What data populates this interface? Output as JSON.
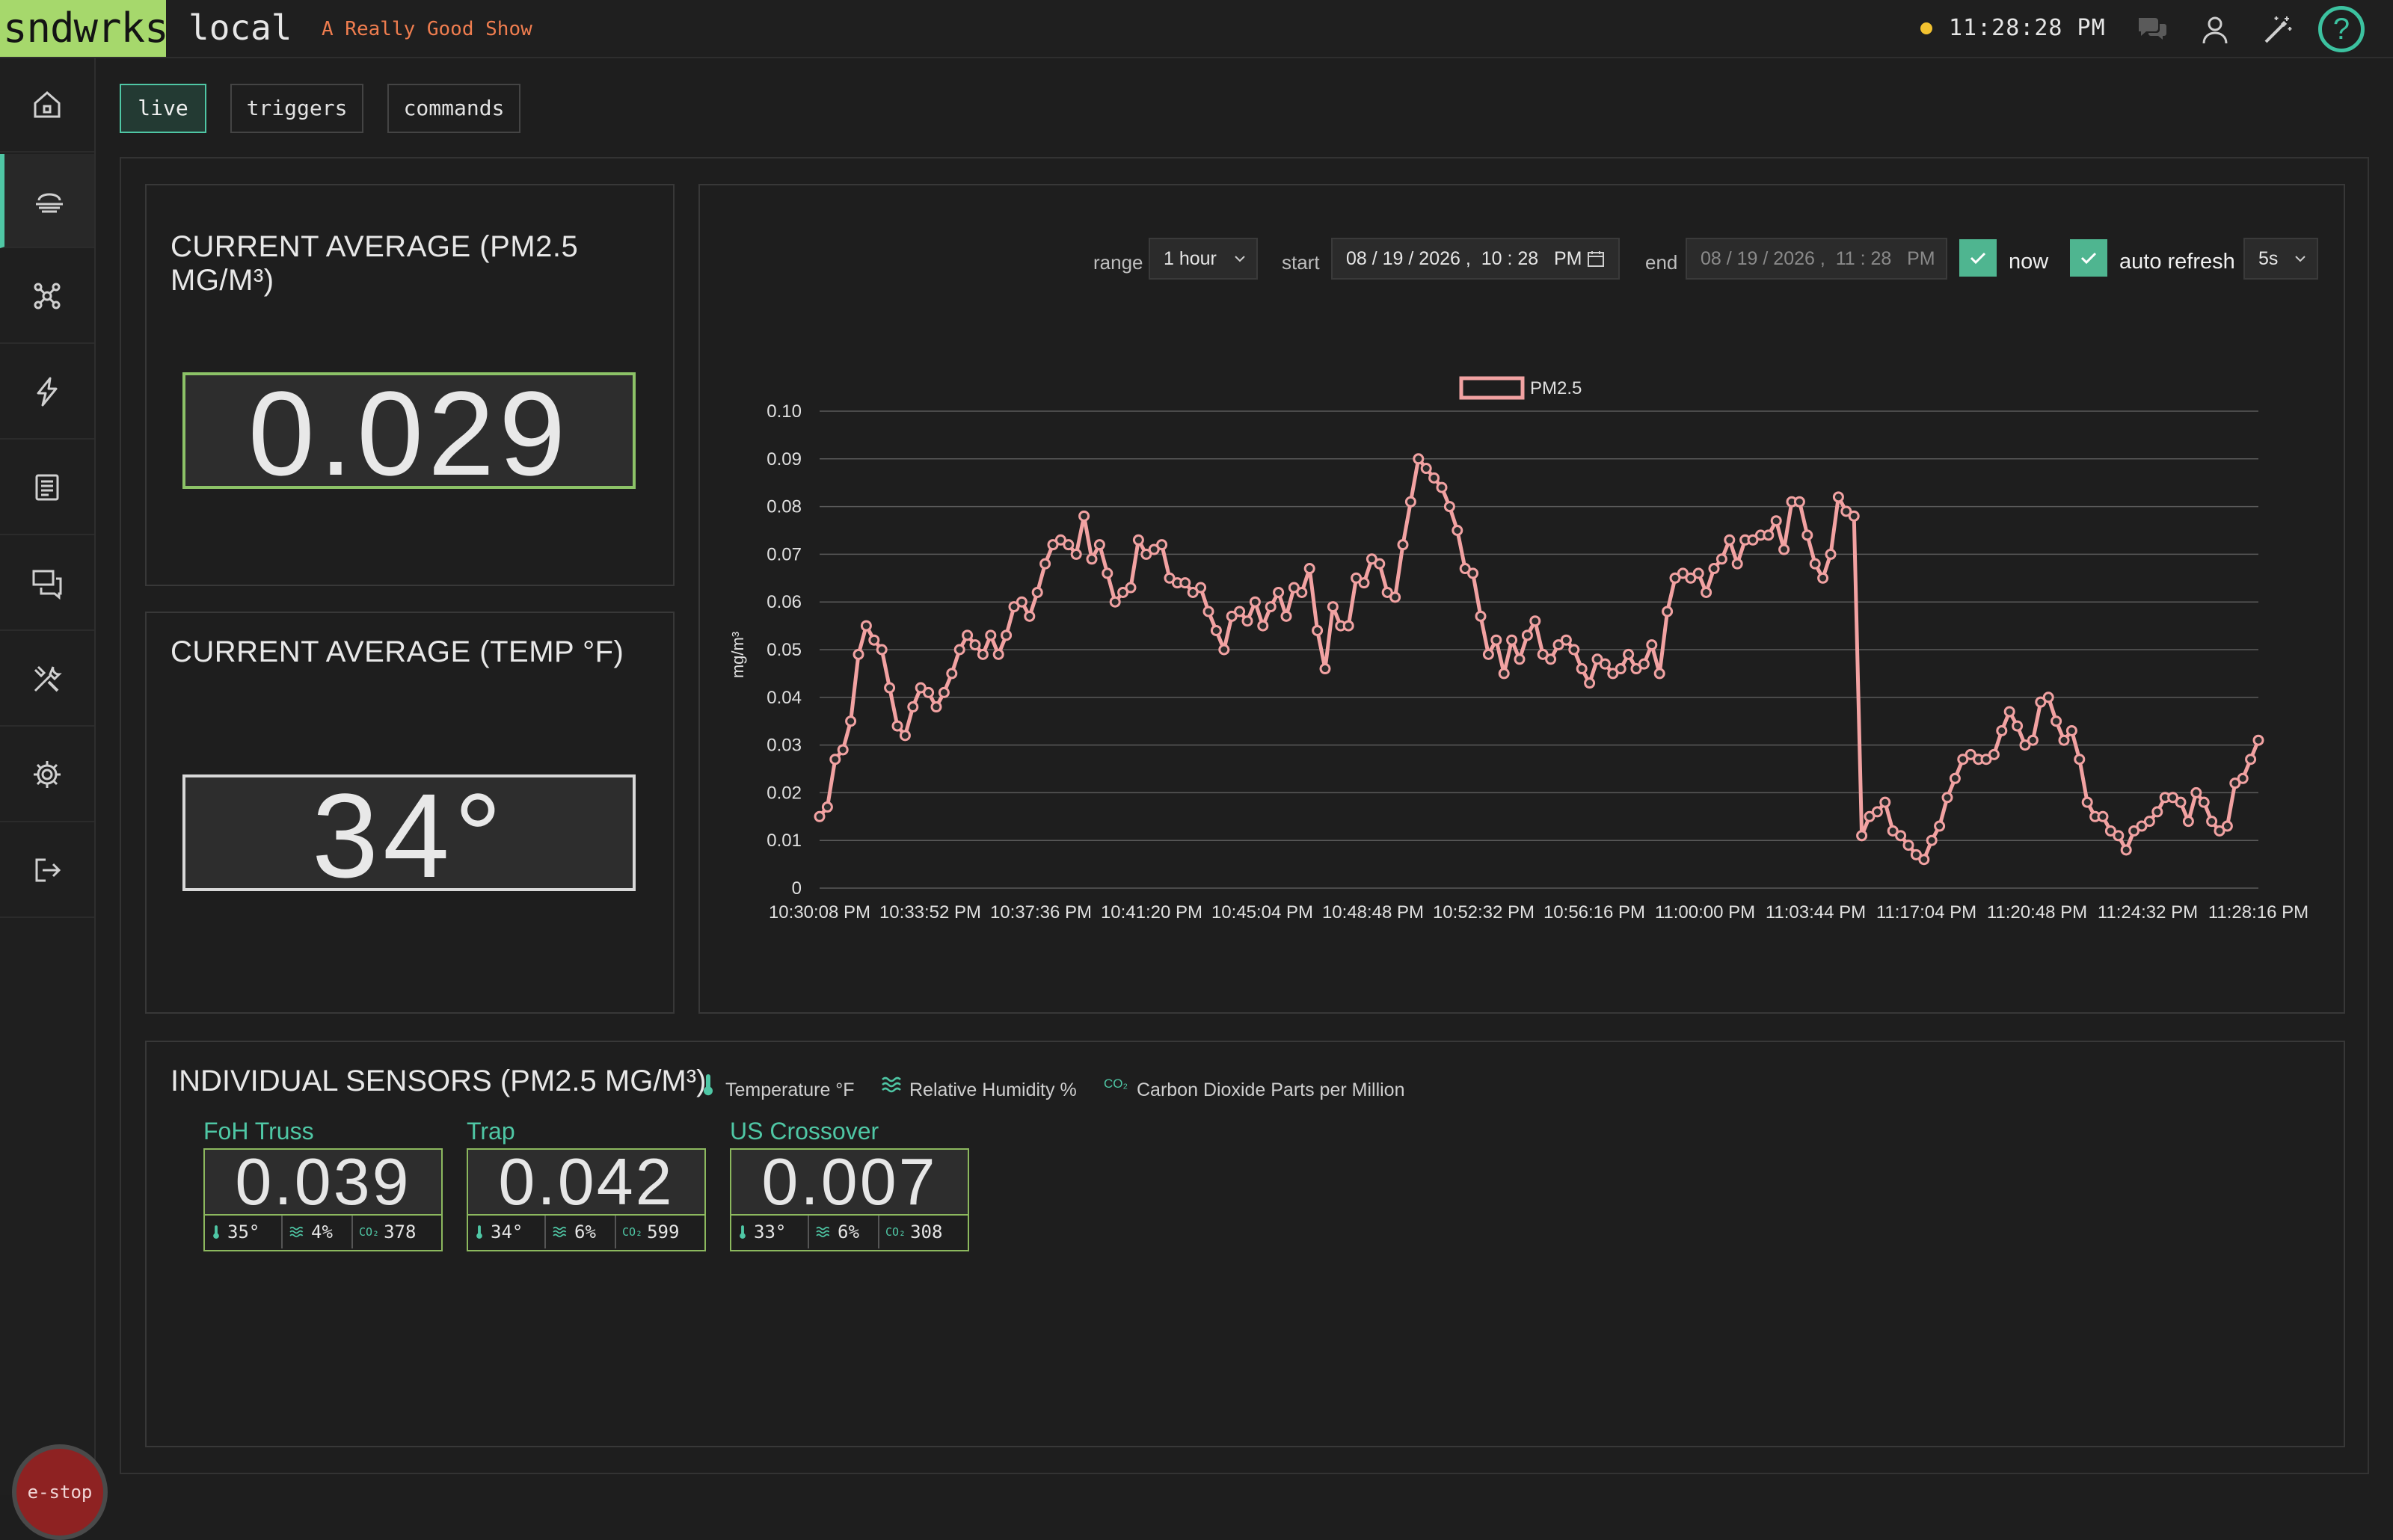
{
  "header": {
    "logo": "sndwrks",
    "app_name": "local",
    "show_name": "A Really Good Show",
    "clock": "11:28:28 PM",
    "help": "?"
  },
  "tabs": [
    {
      "label": "live",
      "active": true
    },
    {
      "label": "triggers",
      "active": false
    },
    {
      "label": "commands",
      "active": false
    }
  ],
  "sidebar": {
    "items": [
      {
        "icon": "home-icon"
      },
      {
        "icon": "air-quality-icon",
        "active": true
      },
      {
        "icon": "network-icon"
      },
      {
        "icon": "lightning-icon"
      },
      {
        "icon": "document-icon"
      },
      {
        "icon": "chat-icon"
      },
      {
        "icon": "tools-icon"
      },
      {
        "icon": "gear-icon"
      },
      {
        "icon": "logout-icon"
      }
    ],
    "estop": "e-stop"
  },
  "current_pm": {
    "title": "CURRENT AVERAGE (PM2.5 MG/M³)",
    "value": "0.029"
  },
  "current_temp": {
    "title": "CURRENT AVERAGE (TEMP °F)",
    "value": "34°"
  },
  "controls": {
    "range_label": "range",
    "range_value": "1 hour",
    "start_label": "start",
    "start_value": "08 / 19 / 2026 ,  10 : 28   PM",
    "end_label": "end",
    "end_value": "08 / 19 / 2026 ,  11 : 28   PM",
    "now_label": "now",
    "now_checked": true,
    "autorefresh_label": "auto refresh",
    "autorefresh_checked": true,
    "interval_value": "5s"
  },
  "chart_data": {
    "type": "line",
    "series": [
      {
        "name": "PM2.5",
        "color": "#f2a2a2",
        "values": [
          0.015,
          0.017,
          0.027,
          0.029,
          0.035,
          0.049,
          0.055,
          0.052,
          0.05,
          0.042,
          0.034,
          0.032,
          0.038,
          0.042,
          0.041,
          0.038,
          0.041,
          0.045,
          0.05,
          0.053,
          0.051,
          0.049,
          0.053,
          0.049,
          0.053,
          0.059,
          0.06,
          0.057,
          0.062,
          0.068,
          0.072,
          0.073,
          0.072,
          0.07,
          0.078,
          0.069,
          0.072,
          0.066,
          0.06,
          0.062,
          0.063,
          0.073,
          0.07,
          0.071,
          0.072,
          0.065,
          0.064,
          0.064,
          0.062,
          0.063,
          0.058,
          0.054,
          0.05,
          0.057,
          0.058,
          0.056,
          0.06,
          0.055,
          0.059,
          0.062,
          0.057,
          0.063,
          0.062,
          0.067,
          0.054,
          0.046,
          0.059,
          0.055,
          0.055,
          0.065,
          0.064,
          0.069,
          0.068,
          0.062,
          0.061,
          0.072,
          0.081,
          0.09,
          0.088,
          0.086,
          0.084,
          0.08,
          0.075,
          0.067,
          0.066,
          0.057,
          0.049,
          0.052,
          0.045,
          0.052,
          0.048,
          0.053,
          0.056,
          0.049,
          0.048,
          0.051,
          0.052,
          0.05,
          0.046,
          0.043,
          0.048,
          0.047,
          0.045,
          0.046,
          0.049,
          0.046,
          0.047,
          0.051,
          0.045,
          0.058,
          0.065,
          0.066,
          0.065,
          0.066,
          0.062,
          0.067,
          0.069,
          0.073,
          0.068,
          0.073,
          0.073,
          0.074,
          0.074,
          0.077,
          0.071,
          0.081,
          0.081,
          0.074,
          0.068,
          0.065,
          0.07,
          0.082,
          0.079,
          0.078,
          0.011,
          0.015,
          0.016,
          0.018,
          0.012,
          0.011,
          0.009,
          0.007,
          0.006,
          0.01,
          0.013,
          0.019,
          0.023,
          0.027,
          0.028,
          0.027,
          0.027,
          0.028,
          0.033,
          0.037,
          0.034,
          0.03,
          0.031,
          0.039,
          0.04,
          0.035,
          0.031,
          0.033,
          0.027,
          0.018,
          0.015,
          0.015,
          0.012,
          0.011,
          0.008,
          0.012,
          0.013,
          0.014,
          0.016,
          0.019,
          0.019,
          0.018,
          0.014,
          0.02,
          0.018,
          0.014,
          0.012,
          0.013,
          0.022,
          0.023,
          0.027,
          0.031
        ]
      }
    ],
    "x_tick_labels": [
      "10:30:08 PM",
      "10:33:52 PM",
      "10:37:36 PM",
      "10:41:20 PM",
      "10:45:04 PM",
      "10:48:48 PM",
      "10:52:32 PM",
      "10:56:16 PM",
      "11:00:00 PM",
      "11:03:44 PM",
      "11:17:04 PM",
      "11:20:48 PM",
      "11:24:32 PM",
      "11:28:16 PM"
    ],
    "y_ticks": [
      "0",
      "0.01",
      "0.02",
      "0.03",
      "0.04",
      "0.05",
      "0.06",
      "0.07",
      "0.08",
      "0.09",
      "0.10"
    ],
    "ylim": [
      0,
      0.1
    ],
    "ylabel": "mg/m³",
    "legend": "top",
    "grid": true
  },
  "sensors": {
    "title": "INDIVIDUAL SENSORS (PM2.5 MG/M³)",
    "legend": {
      "temp": "Temperature °F",
      "humidity": "Relative Humidity %",
      "co2_tag": "CO₂",
      "co2": "Carbon Dioxide Parts per Million"
    },
    "items": [
      {
        "name": "FoH Truss",
        "value": "0.039",
        "temp": "35°",
        "humidity": "4%",
        "co2": "378"
      },
      {
        "name": "Trap",
        "value": "0.042",
        "temp": "34°",
        "humidity": "6%",
        "co2": "599"
      },
      {
        "name": "US Crossover",
        "value": "0.007",
        "temp": "33°",
        "humidity": "6%",
        "co2": "308"
      }
    ]
  }
}
